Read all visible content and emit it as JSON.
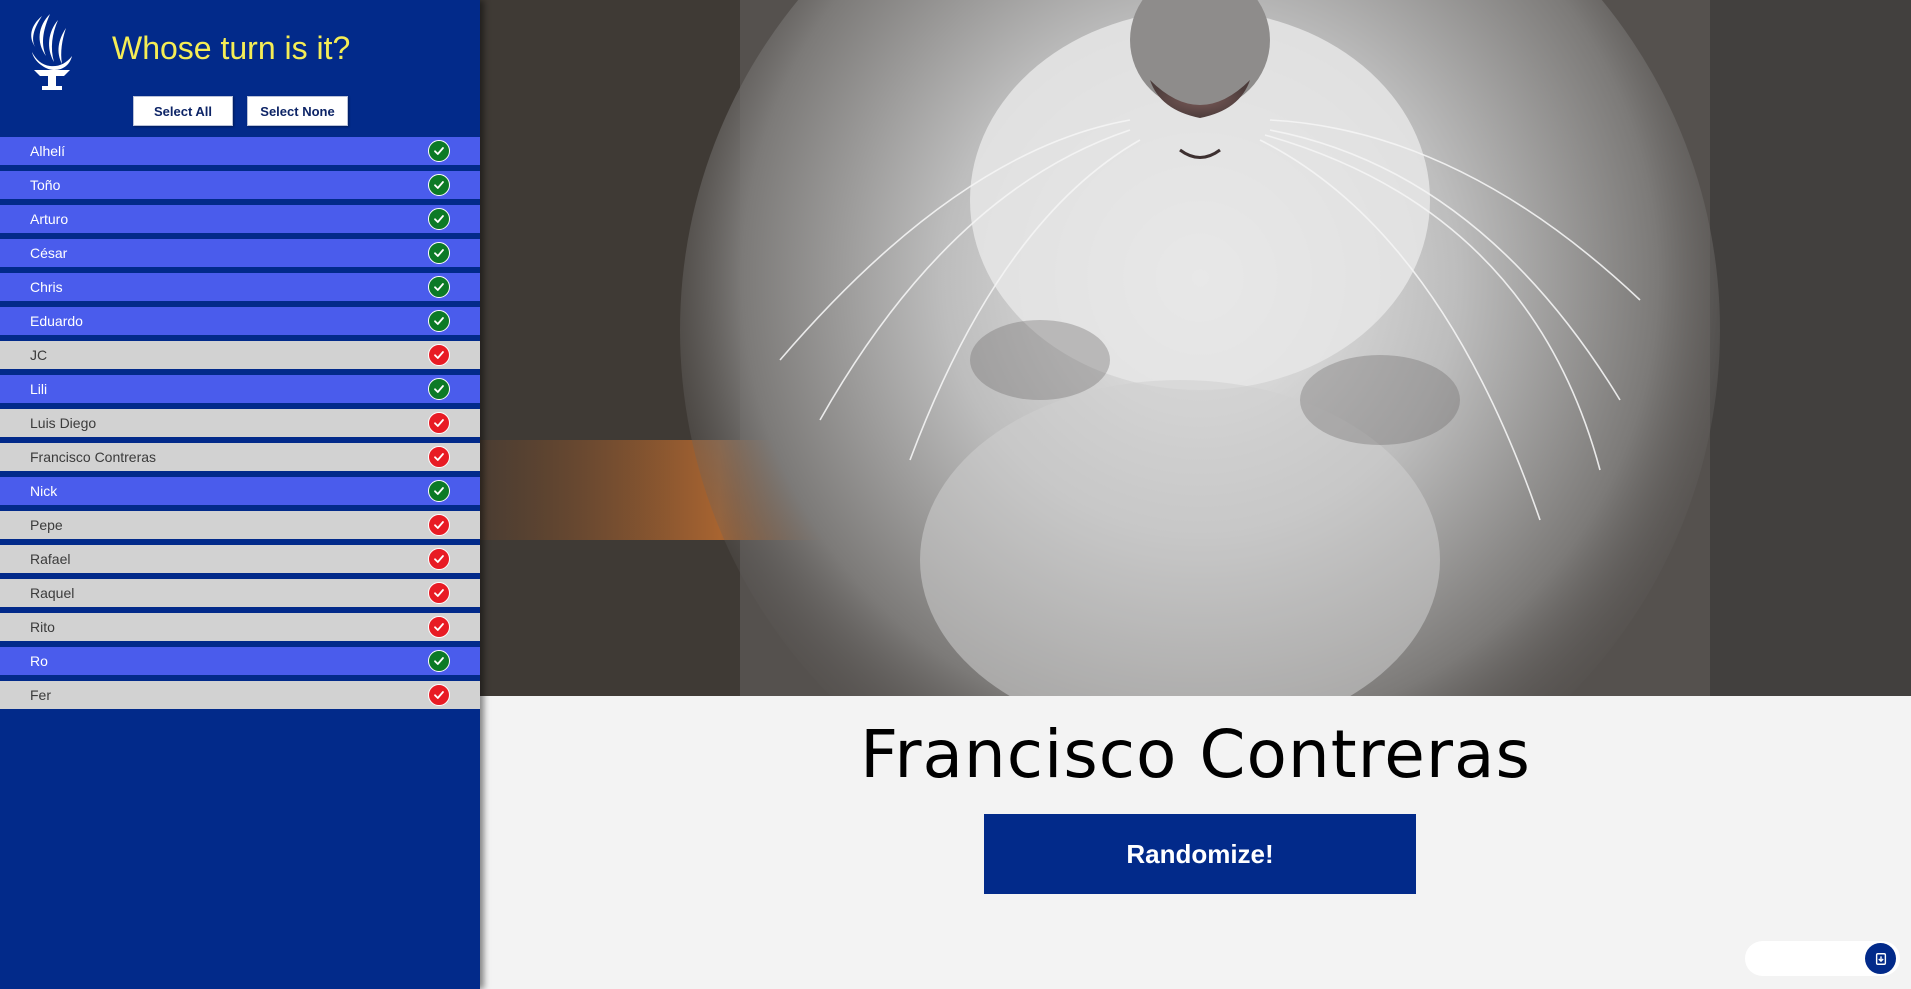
{
  "header": {
    "title": "Whose turn is it?",
    "logo_icon": "torch-flame-logo"
  },
  "controls": {
    "select_all": "Select All",
    "select_none": "Select None"
  },
  "people": [
    {
      "name": "Alhelí",
      "selected": true
    },
    {
      "name": "Toño",
      "selected": true
    },
    {
      "name": "Arturo",
      "selected": true
    },
    {
      "name": "César",
      "selected": true
    },
    {
      "name": "Chris",
      "selected": true
    },
    {
      "name": "Eduardo",
      "selected": true
    },
    {
      "name": "JC",
      "selected": false
    },
    {
      "name": "Lili",
      "selected": true
    },
    {
      "name": "Luis Diego",
      "selected": false
    },
    {
      "name": "Francisco Contreras",
      "selected": false
    },
    {
      "name": "Nick",
      "selected": true
    },
    {
      "name": "Pepe",
      "selected": false
    },
    {
      "name": "Rafael",
      "selected": false
    },
    {
      "name": "Raquel",
      "selected": false
    },
    {
      "name": "Rito",
      "selected": false
    },
    {
      "name": "Ro",
      "selected": true
    },
    {
      "name": "Fer",
      "selected": false
    }
  ],
  "main": {
    "chosen_name": "Francisco Contreras",
    "randomize_label": "Randomize!",
    "photo_subject": "kitten-photo"
  },
  "colors": {
    "primary_blue": "#022a8a",
    "title_yellow": "#f5ed55",
    "selected_row": "#4a5cec",
    "unselected_row": "#d2d2d2",
    "check_on": "#0c7a26",
    "check_off": "#e81b24"
  },
  "widget": {
    "icon": "download-app-icon"
  }
}
